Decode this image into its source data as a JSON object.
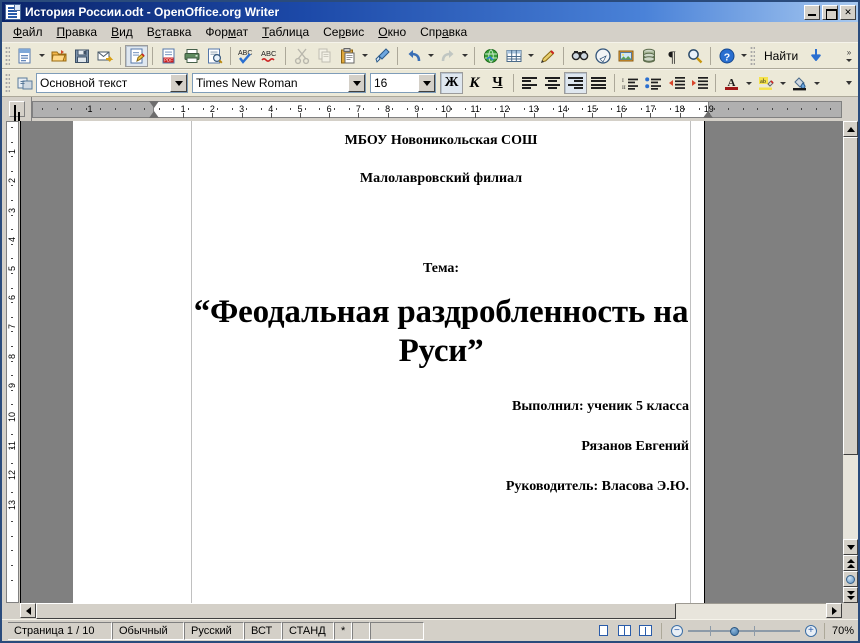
{
  "window": {
    "title": "История России.odt - OpenOffice.org Writer",
    "icon": "writer-document-icon",
    "minimize_label": "",
    "maximize_label": "",
    "close_label": "✕"
  },
  "menubar": {
    "items": [
      {
        "label": "Файл",
        "name": "menu-file"
      },
      {
        "label": "Правка",
        "name": "menu-edit"
      },
      {
        "label": "Вид",
        "name": "menu-view"
      },
      {
        "label": "Вставка",
        "name": "menu-insert"
      },
      {
        "label": "Формат",
        "name": "menu-format"
      },
      {
        "label": "Таблица",
        "name": "menu-table"
      },
      {
        "label": "Сервис",
        "name": "menu-tools"
      },
      {
        "label": "Окно",
        "name": "menu-window"
      },
      {
        "label": "Справка",
        "name": "menu-help"
      }
    ]
  },
  "standard_toolbar": {
    "find_label": "Найти",
    "overflow_label": "»",
    "buttons": [
      "new-document-icon",
      "open-document-icon",
      "save-icon",
      "email-document-icon",
      "edit-file-icon",
      "export-pdf-icon",
      "print-icon",
      "print-preview-icon",
      "spellcheck-icon",
      "autospellcheck-icon",
      "cut-icon",
      "copy-icon",
      "paste-icon",
      "clone-formatting-icon",
      "undo-icon",
      "redo-icon",
      "hyperlink-icon",
      "table-icon",
      "draw-functions-icon",
      "find-replace-icon",
      "navigator-icon",
      "gallery-icon",
      "data-sources-icon",
      "formatting-marks-icon",
      "zoom-icon",
      "help-icon",
      "find-toolbar-icon",
      "find-down-icon"
    ]
  },
  "format_toolbar": {
    "style_value": "Основной текст",
    "font_value": "Times New Roman",
    "size_value": "16",
    "bold_label": "Ж",
    "italic_label": "К",
    "underline_label": "Ч",
    "bold_active": true,
    "align_right_active": true,
    "buttons": [
      "paragraph-style-icon",
      "align-left-icon",
      "align-center-icon",
      "align-right-icon",
      "align-justify-icon",
      "numbered-list-icon",
      "bulleted-list-icon",
      "decrease-indent-icon",
      "increase-indent-icon",
      "font-color-icon",
      "highlighting-icon",
      "background-color-icon"
    ]
  },
  "ruler": {
    "tab_selector": "tab-stop-selector",
    "horizontal_numbers": [
      "1",
      "1",
      "2",
      "3",
      "4",
      "5",
      "6",
      "7",
      "8",
      "9",
      "10",
      "11",
      "12",
      "13",
      "14",
      "15",
      "16",
      "17",
      "18",
      "19"
    ],
    "vertical_numbers": [
      "1",
      "2",
      "3",
      "4",
      "5",
      "6",
      "7",
      "8",
      "9",
      "10",
      "11",
      "12",
      "13"
    ]
  },
  "document": {
    "paragraphs": [
      {
        "text": "МБОУ Новоникольская СОШ",
        "align": "center",
        "style": "head"
      },
      {
        "text": "Малолавровский филиал",
        "align": "center",
        "style": "sub"
      },
      {
        "text": "Тема:",
        "align": "center",
        "style": "tema"
      },
      {
        "text": "“Феодальная раздробленность на Руси”",
        "align": "center",
        "style": "title"
      },
      {
        "text": "Выполнил: ученик 5 класса",
        "align": "right",
        "style": "auth"
      },
      {
        "text": "Рязанов Евгений",
        "align": "right",
        "style": "auth2"
      },
      {
        "text": "Руководитель: Власова Э.Ю.",
        "align": "right",
        "style": "auth3"
      }
    ]
  },
  "statusbar": {
    "page": "Страница  1 / 10",
    "page_style": "Обычный",
    "language": "Русский",
    "insert_mode": "ВСТ",
    "selection_mode": "СТАНД",
    "modified": "*",
    "digital_signature": "",
    "extra": "",
    "view_single_page": "single-page-view-icon",
    "view_multi_page": "multi-page-view-icon",
    "view_book": "book-view-icon",
    "zoom_out": "−",
    "zoom_in": "+",
    "zoom_value": "70%"
  },
  "colors": {
    "title_bar_start": "#0a246a",
    "title_bar_end": "#a6c8f0",
    "toolbar_bg": "#ece9d8",
    "window_bg": "#d4d0c8",
    "canvas_bg": "#808080",
    "page_bg": "#ffffff",
    "accent": "#2a5caa"
  }
}
